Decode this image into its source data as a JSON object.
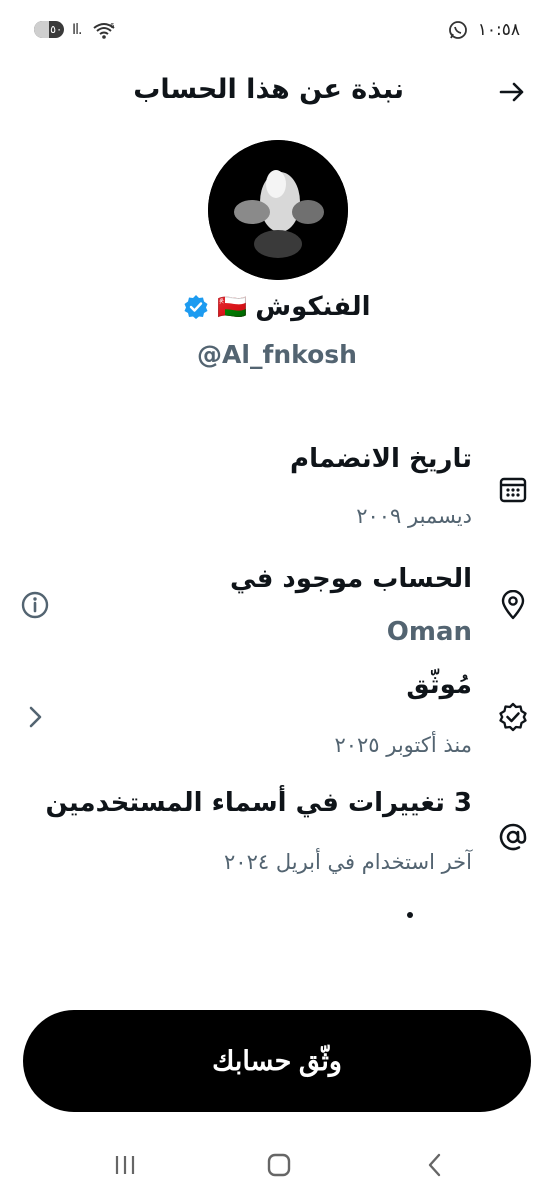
{
  "status_bar": {
    "time": "١٠:٥٨",
    "battery": "٥٠",
    "battery_level": 0.5,
    "signal": "Il.",
    "network": "6"
  },
  "header": {
    "back_icon": "arrow-right-icon",
    "title": "نبذة عن هذا الحساب"
  },
  "profile": {
    "display_name": "الفنكوش",
    "flag": "🇴🇲",
    "verified_icon": "verified-badge-icon",
    "handle": "@Al_fnkosh"
  },
  "rows": {
    "joined": {
      "icon": "calendar-icon",
      "title": "تاريخ الانضمام",
      "value": "ديسمبر ٢٠٠٩"
    },
    "location": {
      "icon": "location-pin-icon",
      "title": "الحساب موجود في",
      "value": "Oman",
      "side_icon": "info-icon"
    },
    "verified": {
      "icon": "verified-check-icon",
      "title": "مُوثّق",
      "value": "منذ أكتوبر ٢٠٢٥",
      "side_icon": "chevron-right-icon"
    },
    "usernames": {
      "icon": "at-sign-icon",
      "title": "3 تغييرات في أسماء المستخدمين",
      "value": "آخر استخدام في أبريل ٢٠٢٤"
    }
  },
  "cta": {
    "label": "وثّق حسابك"
  },
  "nav": {
    "recents": "recents-icon",
    "home": "home-icon",
    "back": "back-icon"
  },
  "colors": {
    "text": "#0f1419",
    "secondary": "#536471",
    "verified_blue": "#1d9bf0",
    "button_bg": "#000000"
  }
}
